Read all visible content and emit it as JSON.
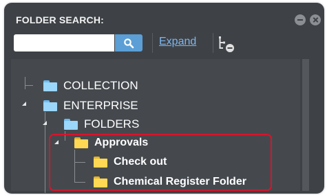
{
  "panel": {
    "title": "FOLDER SEARCH:",
    "minimize_icon": "minimize-circle-icon",
    "close_icon": "close-circle-icon"
  },
  "search": {
    "value": "",
    "placeholder": "",
    "button_icon": "search-icon"
  },
  "toolbar": {
    "expand_label": "Expand",
    "tree_toggle_icon": "tree-collapse-icon"
  },
  "tree": {
    "nodes": [
      {
        "label": "COLLECTION",
        "folder_color": "blue",
        "expanded": false
      },
      {
        "label": "ENTERPRISE",
        "folder_color": "blue",
        "expanded": true
      },
      {
        "label": "FOLDERS",
        "folder_color": "blue",
        "expanded": true
      },
      {
        "label": "Approvals",
        "folder_color": "yellow",
        "expanded": true
      },
      {
        "label": "Check out",
        "folder_color": "yellow",
        "expanded": false
      },
      {
        "label": "Chemical Register Folder",
        "folder_color": "yellow",
        "expanded": false
      }
    ]
  },
  "colors": {
    "panel_bg": "#3e4247",
    "accent_blue": "#5b9fd6",
    "link": "#7fb6ee",
    "highlight_border": "#d9142b"
  }
}
